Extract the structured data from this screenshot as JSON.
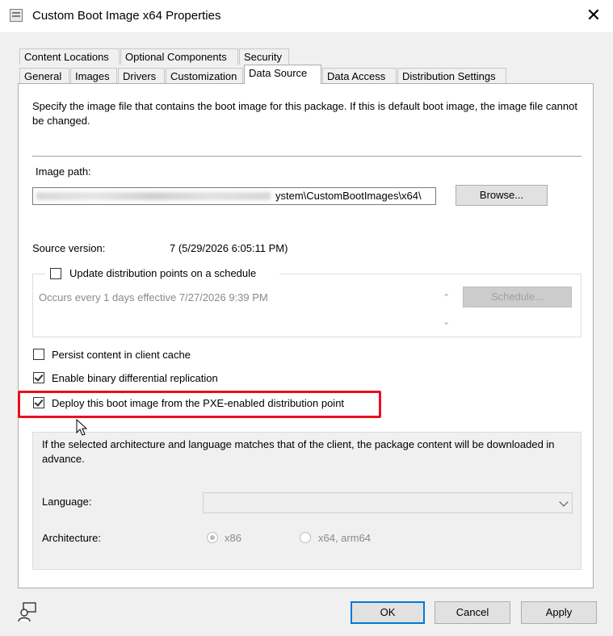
{
  "window": {
    "title": "Custom Boot Image x64 Properties",
    "close_glyph": "✕"
  },
  "tabs": {
    "row1": [
      "Content Locations",
      "Optional Components",
      "Security"
    ],
    "row2": [
      "General",
      "Images",
      "Drivers",
      "Customization",
      "Data Source",
      "Data Access",
      "Distribution Settings"
    ],
    "active": "Data Source"
  },
  "data_source": {
    "description": "Specify the image file that contains the boot image for this package. If this is default boot image, the image file cannot be changed.",
    "image_path_label": "Image path:",
    "image_path_visible": "ystem\\CustomBootImages\\x64\\",
    "browse_label": "Browse...",
    "source_version_label": "Source version:",
    "source_version_value": "7 (5/29/2026 6:05:11 PM)",
    "update_schedule_label": "Update distribution points on a schedule",
    "update_schedule_checked": false,
    "schedule_text": "Occurs every 1 days effective 7/27/2026 9:39 PM",
    "schedule_button": "Schedule...",
    "persist_label": "Persist content in client cache",
    "persist_checked": false,
    "binary_diff_label": "Enable binary differential replication",
    "binary_diff_checked": true,
    "pxe_label": "Deploy this boot image from the PXE-enabled distribution point",
    "pxe_checked": true,
    "advance_text": "If the selected architecture and language matches that of the client, the package content will be downloaded in advance.",
    "language_label": "Language:",
    "language_value": "",
    "architecture_label": "Architecture:",
    "arch_options": [
      "x86",
      "x64, arm64"
    ],
    "arch_selected": "x86"
  },
  "buttons": {
    "ok": "OK",
    "cancel": "Cancel",
    "apply": "Apply"
  },
  "colors": {
    "highlight": "#e8101e",
    "accent": "#0078d7"
  },
  "icons": {
    "window": "properties-window-icon",
    "help": "user-help-icon"
  }
}
